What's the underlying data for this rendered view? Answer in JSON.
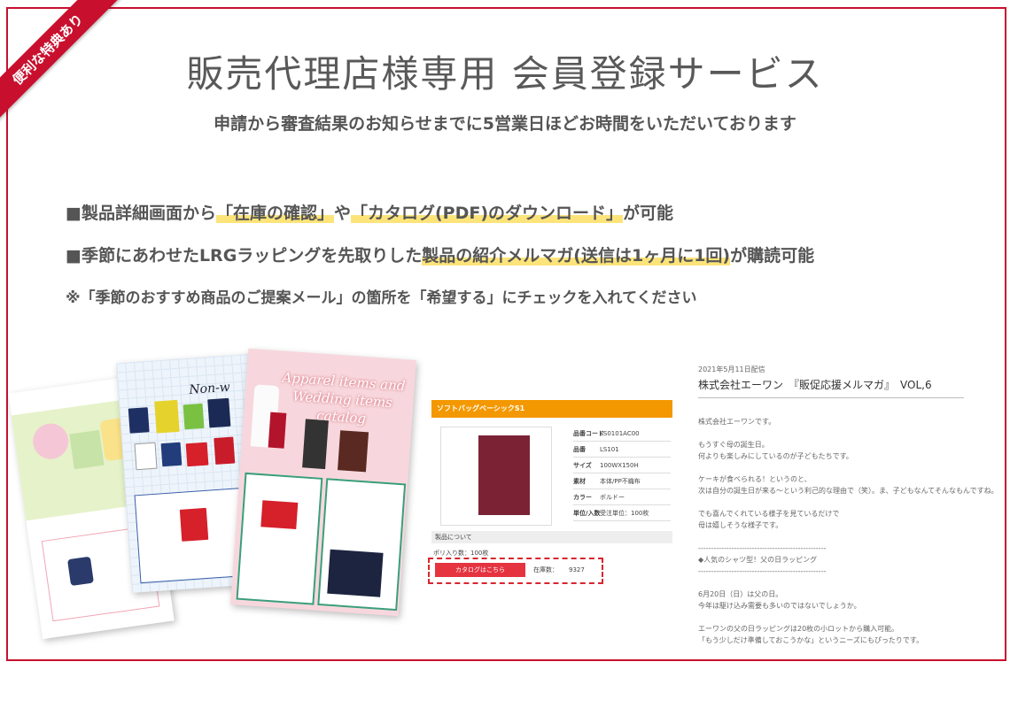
{
  "ribbon": {
    "label": "便利な特典あり"
  },
  "header": {
    "title": "販売代理店様専用 会員登録サービス",
    "subtitle": "申請から審査結果のお知らせまでに5営業日ほどお時間をいただいております"
  },
  "features": [
    {
      "prefix": "■製品詳細画面から",
      "hl1": "「在庫の確認」",
      "mid": "や",
      "hl2": "「カタログ(PDF)のダウンロード」",
      "suffix": "が可能"
    },
    {
      "prefix": "■季節にあわせたLRGラッピングを先取りした",
      "hl1": "製品の紹介メルマガ(送信は1ヶ月に1回)",
      "suffix": "が購読可能"
    }
  ],
  "note": "※「季節のおすすめ商品のご提案メール」の箇所を「希望する」にチェックを入れてください",
  "catalogs": {
    "nonwoven_title": "Non-w",
    "apparel_title": "Apparel items and Wedding items catalog"
  },
  "product_detail": {
    "header": "ソフトバッグベーシックS1",
    "rows": [
      {
        "label": "品番コード",
        "value": "LS0101AC00"
      },
      {
        "label": "品番",
        "value": "LS101"
      },
      {
        "label": "サイズ",
        "value": "100WX150H"
      },
      {
        "label": "素材",
        "value": "本体/PP不織布"
      },
      {
        "label": "カラー",
        "value": "ボルドー"
      },
      {
        "label": "単位/入数",
        "value": "受注単位：100枚"
      }
    ],
    "section": "製品について",
    "bulk": "ポリ入り数：100枚",
    "catalog_button": "カタログはこちら",
    "stock_label": "在庫数：",
    "stock_value": "9327",
    "colors": {
      "header": "#f39800",
      "bag": "#7b2335",
      "button": "#e53340"
    }
  },
  "mail_magazine": {
    "date": "2021年5月11日配信",
    "title": "株式会社エーワン　『販促応援メルマガ』　VOL,6",
    "body": "株式会社エーワンです。\n\nもうすぐ母の誕生日。\n何よりも楽しみにしているのが子どもたちです。\n\nケーキが食べられる！というのと、\n次は自分の誕生日が来る～という利己的な理由で（笑）。ま、子どもなんてそんなもんですね。\n\nでも喜んでくれている様子を見ているだけで\n母は嬉しそうな様子です。\n\n--------------------------------------------------\n◆人気のシャツ型！父の日ラッピング\n--------------------------------------------------\n\n6月20日（日）は父の日。\n今年は駆け込み需要も多いのではないでしょうか。\n\nエーワンの父の日ラッピングは20枚の小ロットから購入可能。\n「もう少しだけ準備しておこうかな」というニーズにもぴったりです。"
  },
  "colors": {
    "accent": "#c8102e",
    "highlight": "#fde47a"
  }
}
